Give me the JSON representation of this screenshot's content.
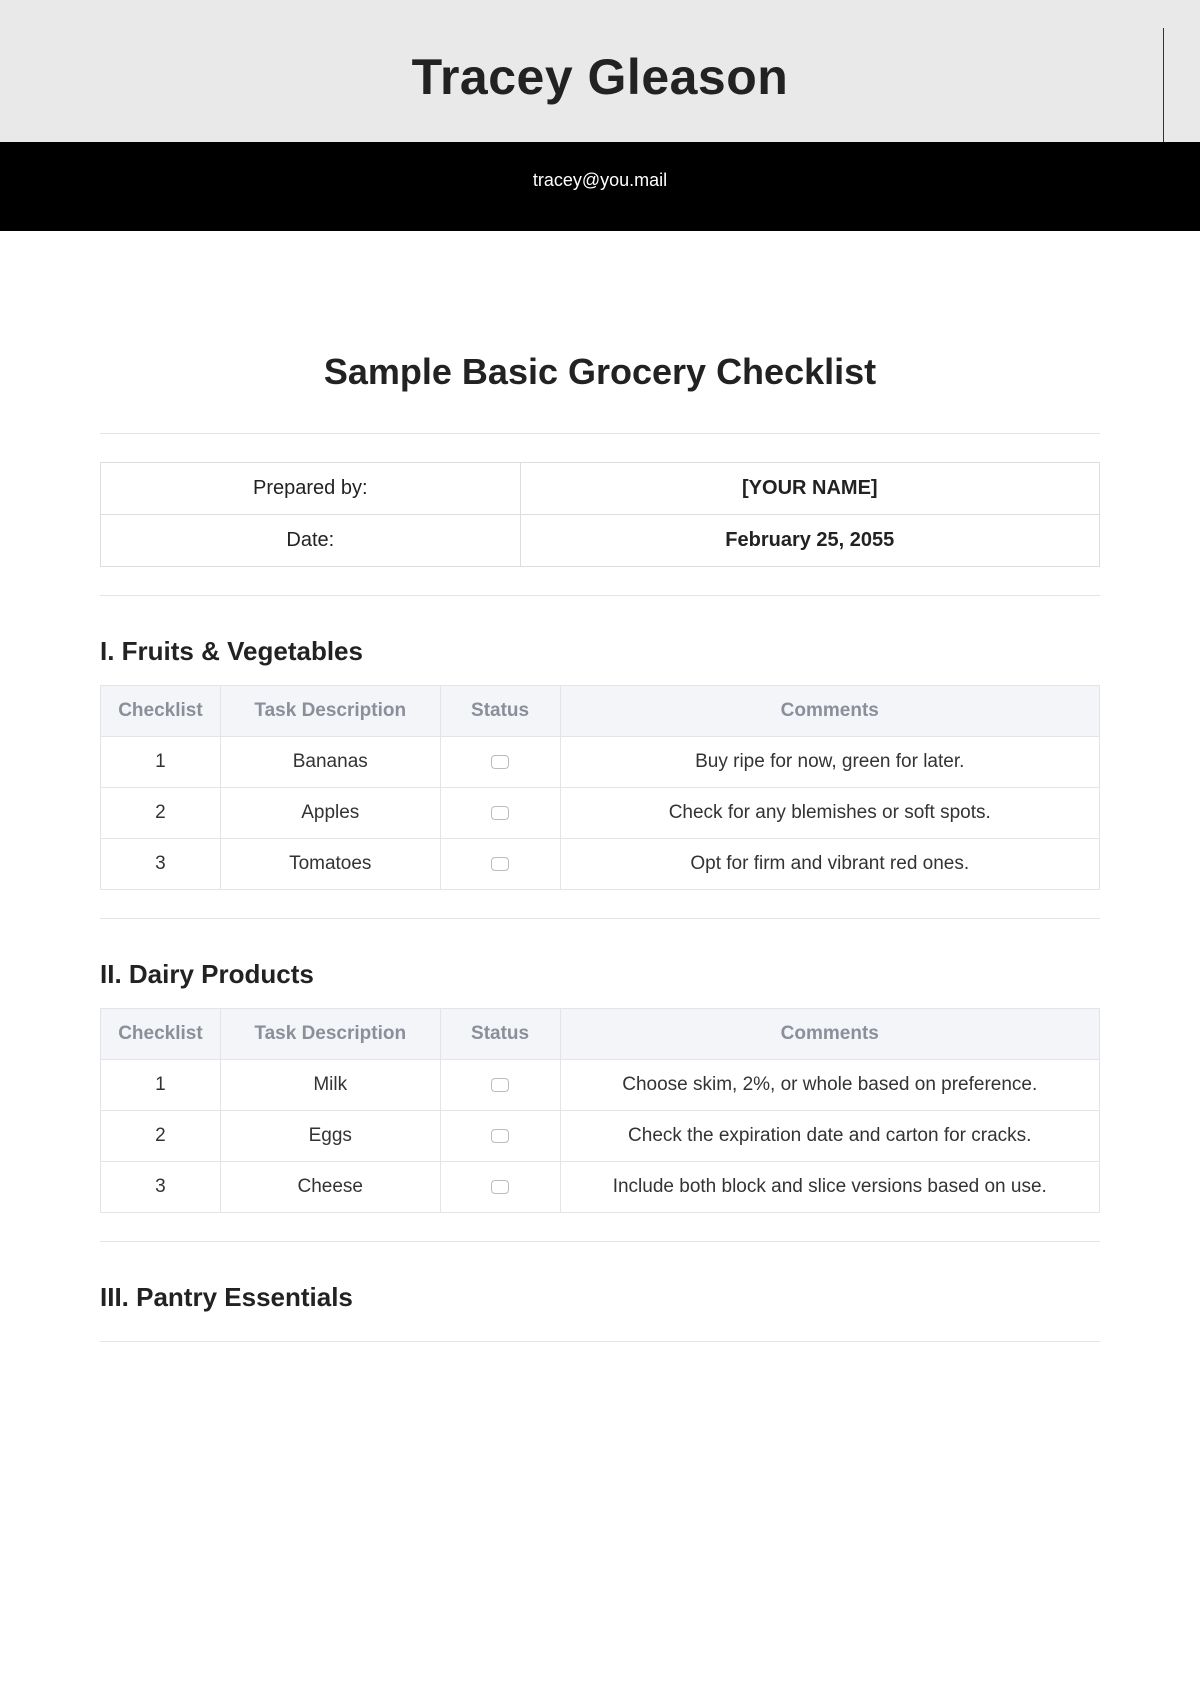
{
  "header": {
    "name": "Tracey Gleason",
    "email": "tracey@you.mail"
  },
  "title": "Sample Basic Grocery Checklist",
  "meta": {
    "prepared_by_label": "Prepared by:",
    "prepared_by_value": "[YOUR NAME]",
    "date_label": "Date:",
    "date_value": "February 25, 2055"
  },
  "columns": {
    "checklist": "Checklist",
    "task": "Task Description",
    "status": "Status",
    "comments": "Comments"
  },
  "sections": [
    {
      "heading": "I. Fruits & Vegetables",
      "rows": [
        {
          "n": "1",
          "task": "Bananas",
          "comment": "Buy ripe for now, green for later."
        },
        {
          "n": "2",
          "task": "Apples",
          "comment": "Check for any blemishes or soft spots."
        },
        {
          "n": "3",
          "task": "Tomatoes",
          "comment": "Opt for firm and vibrant red ones."
        }
      ]
    },
    {
      "heading": "II. Dairy Products",
      "rows": [
        {
          "n": "1",
          "task": "Milk",
          "comment": "Choose skim, 2%, or whole based on preference."
        },
        {
          "n": "2",
          "task": "Eggs",
          "comment": "Check the expiration date and carton for cracks."
        },
        {
          "n": "3",
          "task": "Cheese",
          "comment": "Include both block and slice versions based on use."
        }
      ]
    },
    {
      "heading": "III. Pantry Essentials",
      "rows": []
    }
  ]
}
